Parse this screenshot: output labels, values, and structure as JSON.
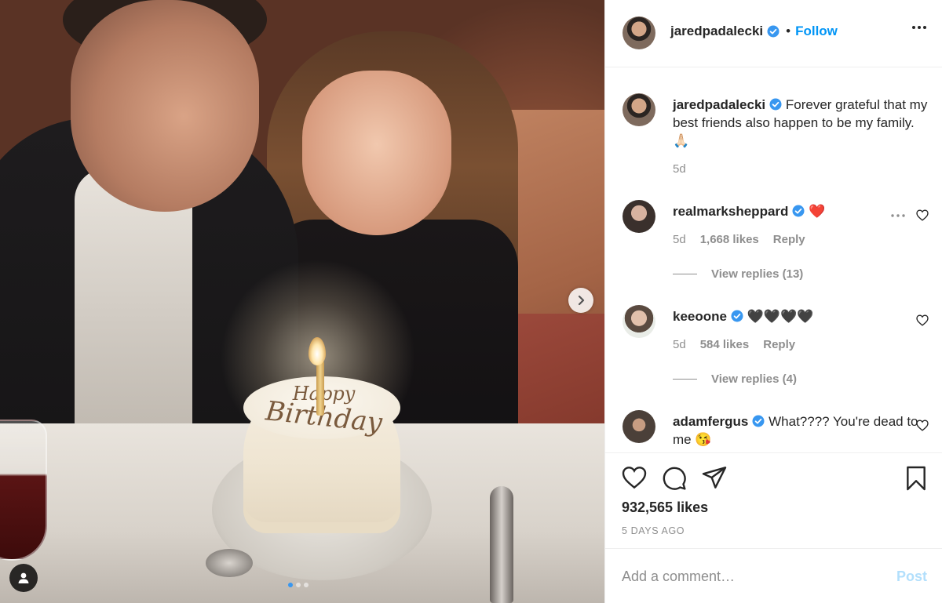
{
  "post": {
    "photo_alt": "",
    "carousel": {
      "total": 3,
      "active": 1
    }
  },
  "header": {
    "username": "jaredpadalecki",
    "separator": "•",
    "follow_label": "Follow",
    "more_icon": "more-horizontal-icon"
  },
  "caption": {
    "username": "jaredpadalecki",
    "text": "Forever grateful that my best friends also happen to be my family. 🙏🏻",
    "time": "5d"
  },
  "comments": [
    {
      "username": "realmarksheppard",
      "text": "❤️",
      "time": "5d",
      "likes": "1,668 likes",
      "reply_label": "Reply",
      "view_replies": "View replies (13)"
    },
    {
      "username": "keeoone",
      "text": "🖤🖤🖤🖤",
      "time": "5d",
      "likes": "584 likes",
      "reply_label": "Reply",
      "view_replies": "View replies (4)"
    },
    {
      "username": "adamfergus",
      "text": "What???? You're dead to me 😘"
    }
  ],
  "actions": {
    "likes": "932,565 likes",
    "time_ago": "5 DAYS AGO"
  },
  "add_comment": {
    "placeholder": "Add a comment…",
    "post_label": "Post"
  },
  "colors": {
    "accent": "#0095f6",
    "verified": "#3897f0",
    "muted": "#8e8e8e",
    "post_disabled": "#b2dffc"
  }
}
